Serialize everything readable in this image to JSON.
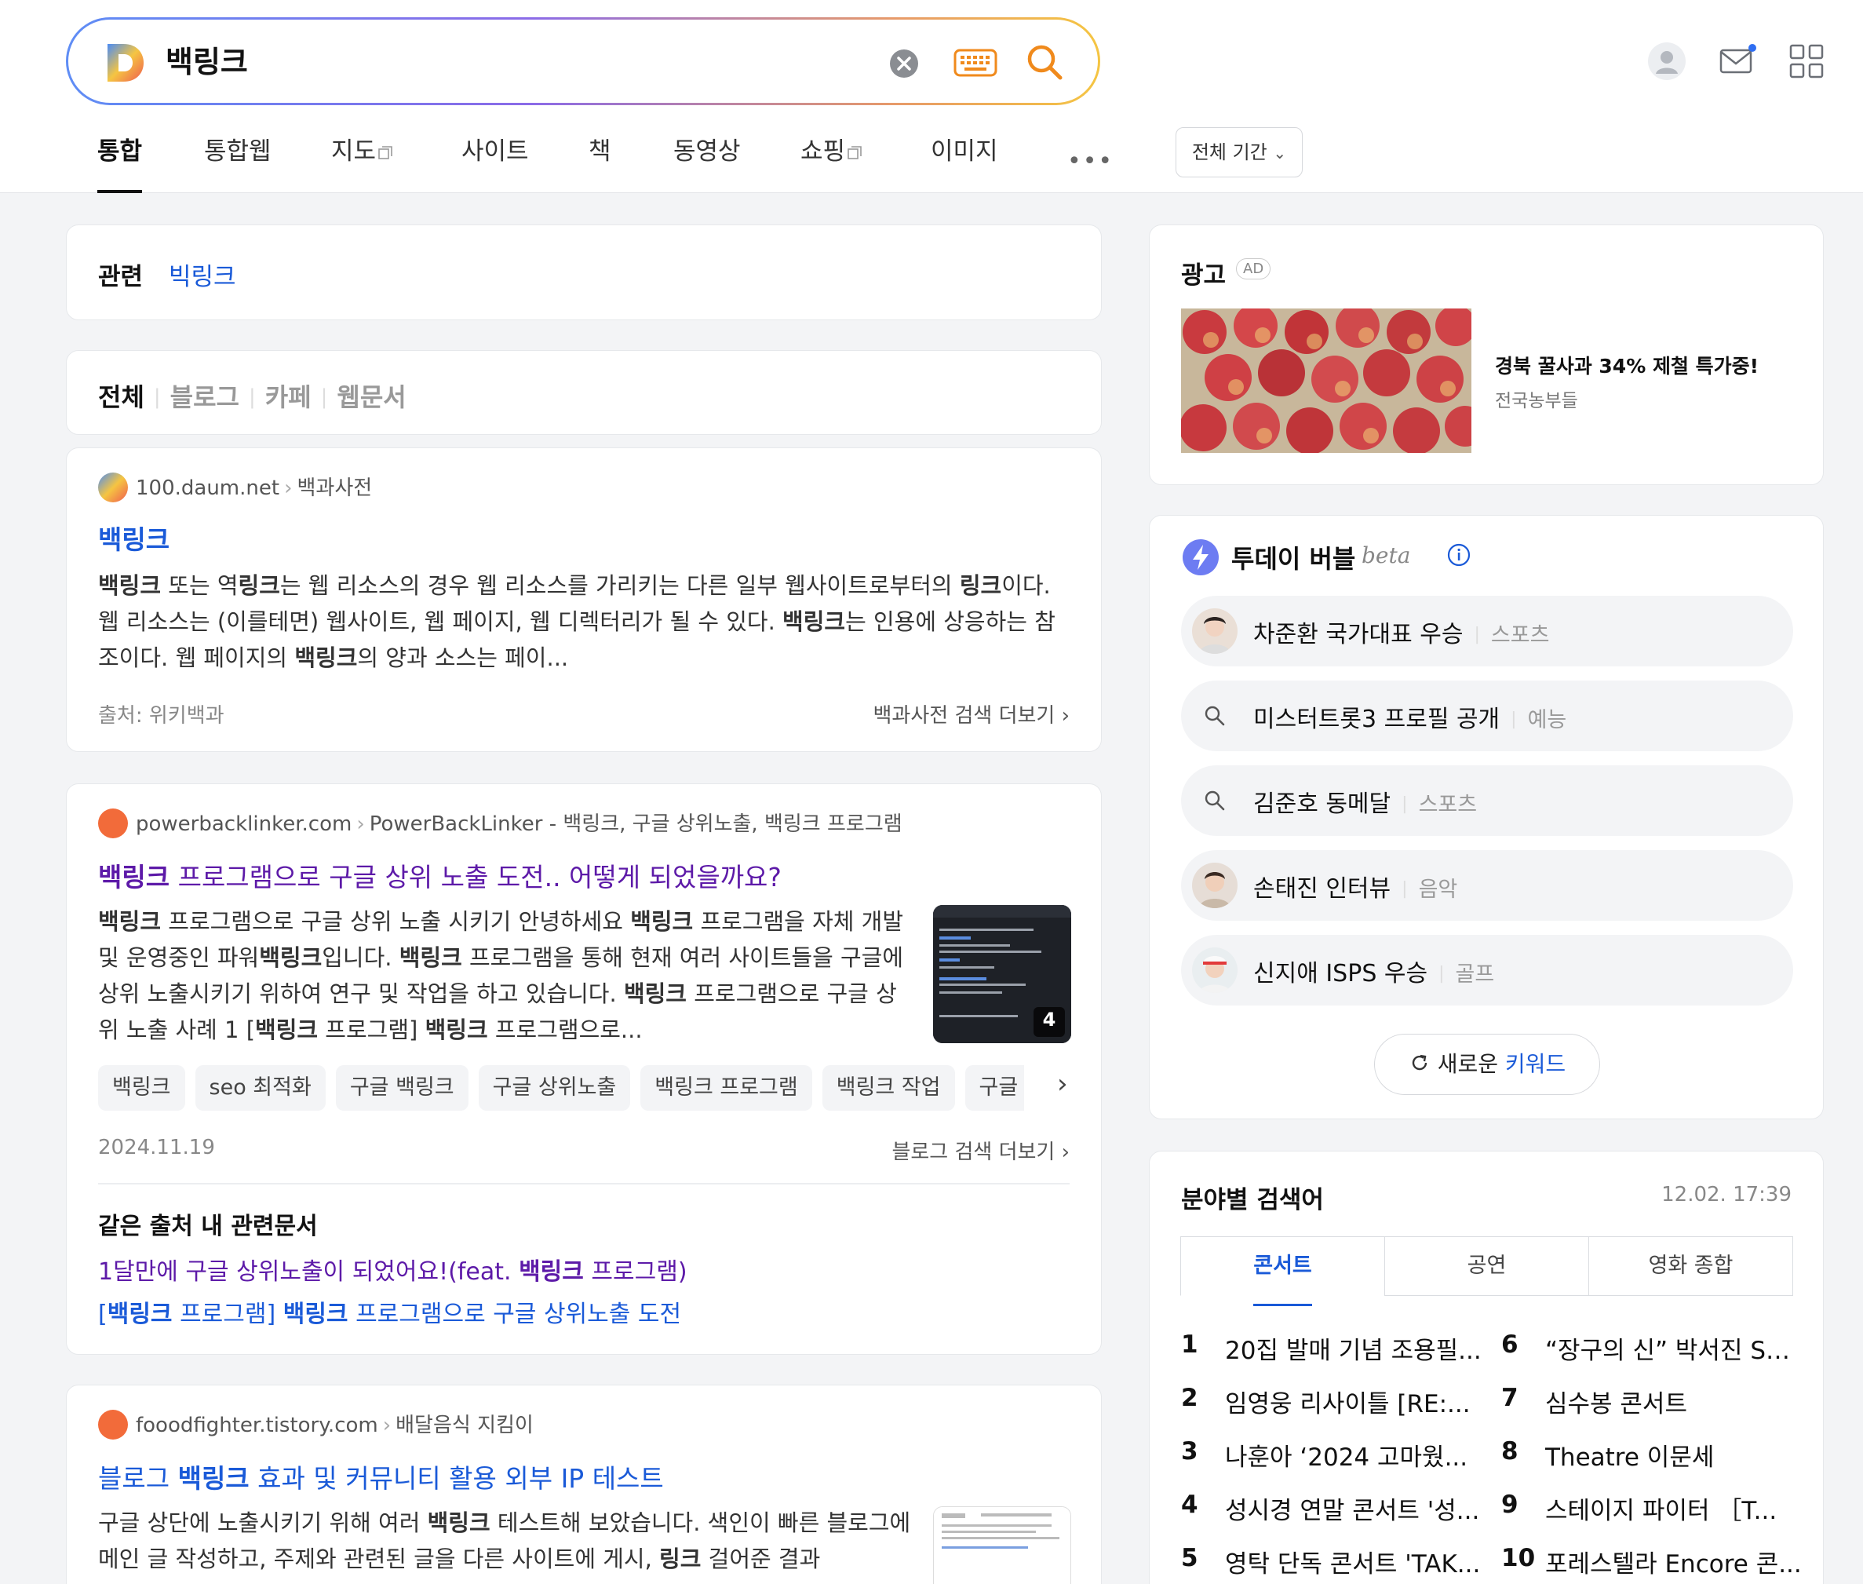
{
  "search": {
    "query": "백링크"
  },
  "tabs": [
    {
      "label": "통합"
    },
    {
      "label": "통합웹"
    },
    {
      "label": "지도"
    },
    {
      "label": "사이트"
    },
    {
      "label": "책"
    },
    {
      "label": "동영상"
    },
    {
      "label": "쇼핑"
    },
    {
      "label": "이미지"
    }
  ],
  "more_label": "•••",
  "period_filter": "전체 기간",
  "related": {
    "title": "관련",
    "link": "빅링크"
  },
  "filters": [
    "전체",
    "블로그",
    "카페",
    "웹문서"
  ],
  "results": [
    {
      "source": "100.daum.net",
      "breadcrumb": "백과사전",
      "title": "백링크",
      "body": "<b>백링크</b> 또는 역<b>링크</b>는 웹 리소스의 경우 웹 리소스를 가리키는 다른 일부 웹사이트로부터의 <b>링크</b>이다.웹 리소스는 (이를테면) 웹사이트, 웹 페이지, 웹 디렉터리가 될 수 있다. <b>백링크</b>는 인용에 상응하는 참조이다. 웹 페이지의 <b>백링크</b>의 양과 소스는 페이...",
      "meta_left": "출처: 위키백과",
      "meta_right": "백과사전 검색 더보기 ›"
    },
    {
      "source": "powerbacklinker.com",
      "breadcrumb": "PowerBackLinker - 백링크, 구글 상위노출, 백링크 프로그램",
      "title": "백링크 프로그램으로 구글 상위 노출 도전.. 어떻게 되었을까요?",
      "body": "<b>백링크</b> 프로그램으로 구글 상위 노출 시키기 안녕하세요 <b>백링크</b> 프로그램을 자체 개발 및 운영중인 파워<b>백링크</b>입니다. <b>백링크</b> 프로그램을 통해 현재 여러 사이트들을 구글에 상위 노출시키기 위하여 연구 및 작업을 하고 있습니다. <b>백링크</b> 프로그램으로 구글 상위 노출 사례 1 [<b>백링크</b> 프로그램] <b>백링크</b> 프로그램으로...",
      "thumb_count": "4",
      "chips": [
        "백링크",
        "seo 최적화",
        "구글 백링크",
        "구글 상위노출",
        "백링크 프로그램",
        "백링크 작업",
        "구글 상위"
      ],
      "date": "2024.11.19",
      "meta_right": "블로그 검색 더보기 ›",
      "same_source_title": "같은 출처 내 관련문서",
      "same_source_links": [
        "1달만에 구글 상위노출이 되었어요!(feat. <b>백링크</b> 프로그램)",
        "[<b>백링크</b> 프로그램] <b>백링크</b> 프로그램으로 구글 상위노출 도전"
      ]
    },
    {
      "source": "fooodfighter.tistory.com",
      "breadcrumb": "배달음식 지킴이",
      "title": "블로그 <b>백링크</b> 효과 및 커뮤니티 활용 외부 IP 테스트",
      "body": "구글 상단에 노출시키기 위해 여러 <b>백링크</b> 테스트해 보았습니다. 색인이 빠른 블로그에 메인 글 작성하고, 주제와 관련된 글을 다른 사이트에 게시, <b>링크</b> 걸어준 결과"
    }
  ],
  "ad": {
    "title": "광고",
    "badge": "AD",
    "headline": "경북 꿀사과 34% 제철 특가중!",
    "advertiser": "전국농부들"
  },
  "today_bubble": {
    "title": "투데이 버블",
    "beta": "beta",
    "items": [
      {
        "keyword": "차준환 국가대표 우승",
        "category": "스포츠",
        "avatar": true
      },
      {
        "keyword": "미스터트롯3 프로필 공개",
        "category": "예능",
        "avatar": false
      },
      {
        "keyword": "김준호 동메달",
        "category": "스포츠",
        "avatar": false
      },
      {
        "keyword": "손태진 인터뷰",
        "category": "음악",
        "avatar": true
      },
      {
        "keyword": "신지애 ISPS 우승",
        "category": "골프",
        "avatar": true
      }
    ],
    "refresh_prefix": "새로운 ",
    "refresh_accent": "키워드"
  },
  "field_keywords": {
    "title": "분야별 검색어",
    "time": "12.02. 17:39",
    "tabs": [
      "콘서트",
      "공연",
      "영화 종합"
    ],
    "ranks": [
      {
        "num": "1",
        "text": "20집 발매 기념 조용필..."
      },
      {
        "num": "2",
        "text": "임영웅 리사이틀 [RE:..."
      },
      {
        "num": "3",
        "text": "나훈아 ‘2024 고마웠..."
      },
      {
        "num": "4",
        "text": "성시경 연말 콘서트 '성..."
      },
      {
        "num": "5",
        "text": "영탁 단독 콘서트 'TAK..."
      },
      {
        "num": "6",
        "text": "“장구의 신” 박서진 Sh..."
      },
      {
        "num": "7",
        "text": "심수봉 콘서트"
      },
      {
        "num": "8",
        "text": "Theatre 이문세"
      },
      {
        "num": "9",
        "text": "스테이지 파이터 ［T..."
      },
      {
        "num": "10",
        "text": "포레스텔라 Encore 콘..."
      }
    ]
  },
  "colors": {
    "link_blue": "#1a5ad8",
    "visited_purple": "#5d1aa8",
    "search_gradient": [
      "#5f8df5",
      "#8b6be8",
      "#e79a6a",
      "#f5c542"
    ],
    "accent_orange": "#f08a1c"
  },
  "icons": [
    "daum-logo-icon",
    "clear-icon",
    "keyboard-icon",
    "search-icon",
    "account-icon",
    "mail-icon",
    "apps-grid-icon",
    "external-window-icon",
    "chevron-right-icon",
    "info-icon",
    "refresh-icon",
    "bolt-icon"
  ]
}
